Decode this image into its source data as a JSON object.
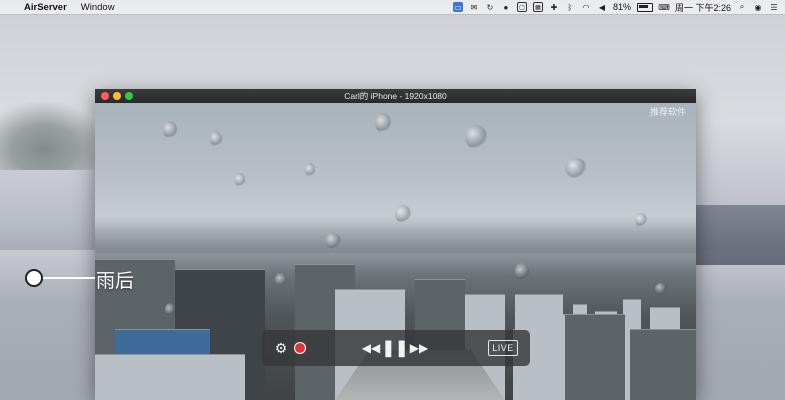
{
  "menubar": {
    "app_name": "AirServer",
    "menus": [
      "Window"
    ],
    "status": {
      "battery_percent": "81%",
      "datetime": "周一 下午2:26"
    }
  },
  "window": {
    "title": "Carl的 iPhone - 1920x1080",
    "video": {
      "watermark": "推荐软件"
    },
    "controls": {
      "rewind_glyph": "◀◀",
      "pause_glyph": "❚❚",
      "forward_glyph": "▶▶",
      "live_label": "LIVE"
    },
    "caption": "雨后"
  }
}
